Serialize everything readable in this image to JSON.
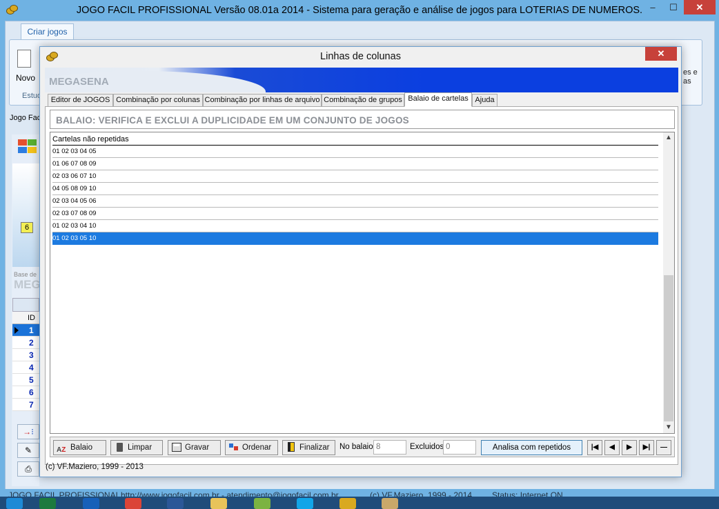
{
  "main_window": {
    "title": "JOGO FACIL PROFISSIONAL  Versão 08.01a  2014 - Sistema para geração e análise de jogos para LOTERIAS DE NUMEROS.",
    "controls": {
      "minimize": "–",
      "maximize": "☐",
      "close": "✕"
    },
    "ribbon_tab": "Criar jogos",
    "novo_label": "Novo",
    "group_label": "Estud",
    "ribbon_right_label": "es e\nas",
    "left_label": "Jogo Fac",
    "badge_value": "6",
    "base_label": "Base de",
    "meg_label": "MEG",
    "id_header": "ID",
    "id_rows": [
      "1",
      "2",
      "3",
      "4",
      "5",
      "6",
      "7"
    ],
    "selected_id": "1",
    "status": {
      "left": "JOGO FACIL PROFISSIONAL",
      "url": "http://www.jogofacil.com.br - atendimento@jogofacil.com.br",
      "copy": "(c) VF.Maziero, 1999 - 2014",
      "state": "Status: Internet ON"
    }
  },
  "dialog": {
    "title": "Linhas de colunas",
    "close": "✕",
    "banner": "MEGASENA",
    "tabs": [
      {
        "label": "Editor de JOGOS",
        "active": false
      },
      {
        "label": "Combinação por colunas",
        "active": false
      },
      {
        "label": "Combinação por linhas de arquivo",
        "active": false
      },
      {
        "label": "Combinação de grupos",
        "active": false
      },
      {
        "label": "Balaio de cartelas",
        "active": true
      },
      {
        "label": "Ajuda",
        "active": false
      }
    ],
    "heading": "BALAIO: VERIFICA E EXCLUI A DUPLICIDADE EM UM CONJUNTO DE JOGOS",
    "list_header": "Cartelas não repetidas",
    "rows": [
      "01 02 03 04 05",
      "01 06 07 08 09",
      "02 03 06 07 10",
      "04 05 08 09 10",
      "02 03 04 05 06",
      "02 03 07 08 09",
      "01 02 03 04 10",
      "01 02 03 05 10"
    ],
    "selected_row": 7,
    "scroll": {
      "up": "▲",
      "down": "▼"
    },
    "buttons": {
      "balaio": "Balaio",
      "limpar": "Limpar",
      "gravar": "Gravar",
      "ordenar": "Ordenar",
      "finalizar": "Finalizar",
      "analisa": "Analisa com repetidos"
    },
    "no_balaio_label": "No balaio",
    "no_balaio_value": "8",
    "excluidos_label": "Excluidos",
    "excluidos_value": "0",
    "nav": {
      "first": "|◀",
      "prev": "◀",
      "next": "▶",
      "last": "▶|",
      "minus": "—"
    },
    "copyright": "(c) VF.Maziero, 1999 - 2013"
  },
  "colors": {
    "banner_blue": "#0b3fe0",
    "selection": "#1c7ae0",
    "close_red": "#c7413a",
    "id_blue": "#0a28b4"
  }
}
